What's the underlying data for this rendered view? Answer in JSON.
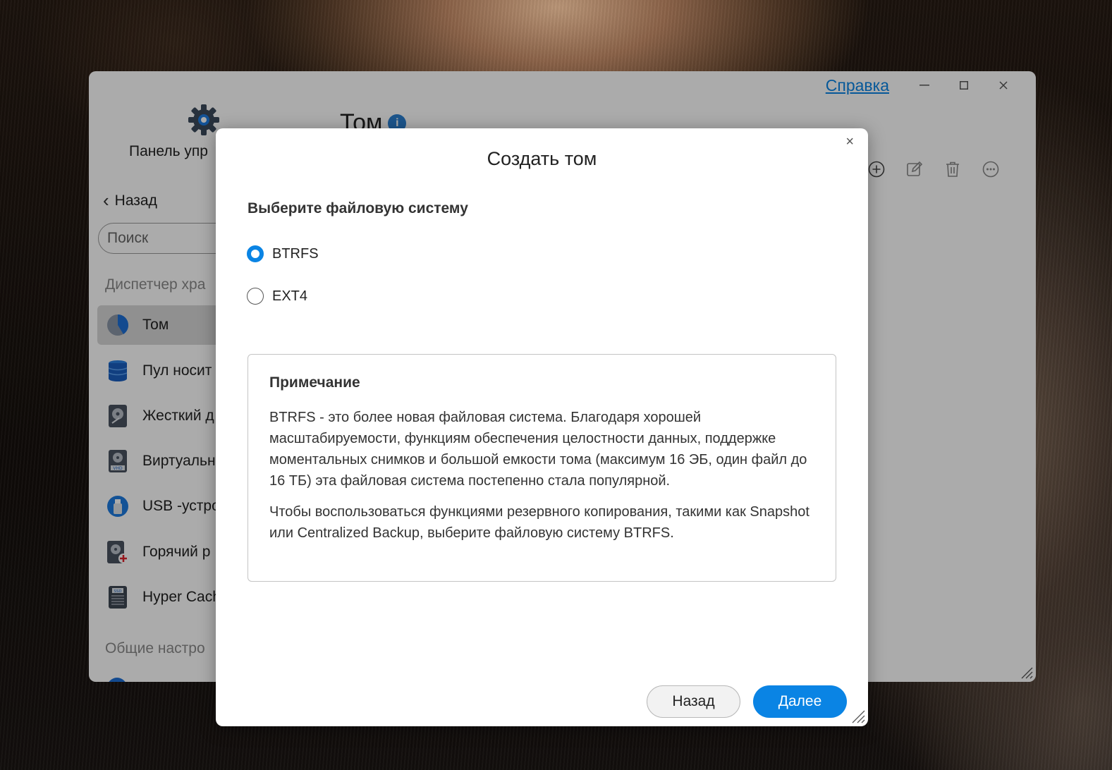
{
  "window": {
    "help_link": "Справка",
    "minimize_icon": "minimize-icon",
    "maximize_icon": "maximize-icon",
    "close_icon": "close-icon"
  },
  "sidebar": {
    "app_title": "Панель упр",
    "back_label": "Назад",
    "search_placeholder": "Поиск",
    "section_storage": "Диспетчер хра",
    "items": [
      {
        "label": "Том",
        "icon": "volume-pie-icon",
        "active": true
      },
      {
        "label": "Пул носит",
        "icon": "storage-pool-icon",
        "active": false
      },
      {
        "label": "Жесткий д",
        "icon": "hard-disk-icon",
        "active": false
      },
      {
        "label": "Виртуальн",
        "icon": "vhd-disk-icon",
        "active": false
      },
      {
        "label": "USB -устро",
        "icon": "usb-icon",
        "active": false
      },
      {
        "label": "Горячий р",
        "icon": "hot-spare-icon",
        "active": false
      },
      {
        "label": "Hyper Cach",
        "icon": "ssd-cache-icon",
        "active": false
      }
    ],
    "section_general": "Общие настро"
  },
  "main": {
    "title": "Том",
    "info_icon": "i",
    "toolbar": [
      "add-icon",
      "edit-icon",
      "trash-icon",
      "more-icon"
    ]
  },
  "modal": {
    "title": "Создать том",
    "close_glyph": "×",
    "fs_label": "Выберите файловую систему",
    "options": [
      {
        "label": "BTRFS",
        "checked": true
      },
      {
        "label": "EXT4",
        "checked": false
      }
    ],
    "note": {
      "title": "Примечание",
      "p1": "BTRFS - это более новая файловая система. Благодаря хорошей масштабируемости, функциям обеспечения целостности данных, поддержке моментальных снимков и большой емкости тома (максимум 16 ЭБ, один файл до 16 ТБ) эта файловая система постепенно стала популярной.",
      "p2": "Чтобы воспользоваться функциями резервного копирования, такими как Snapshot или Centralized Backup, выберите файловую систему BTRFS."
    },
    "back_button": "Назад",
    "next_button": "Далее"
  },
  "colors": {
    "accent": "#0a84e4",
    "overlay": "rgba(0,0,0,0.33)"
  }
}
